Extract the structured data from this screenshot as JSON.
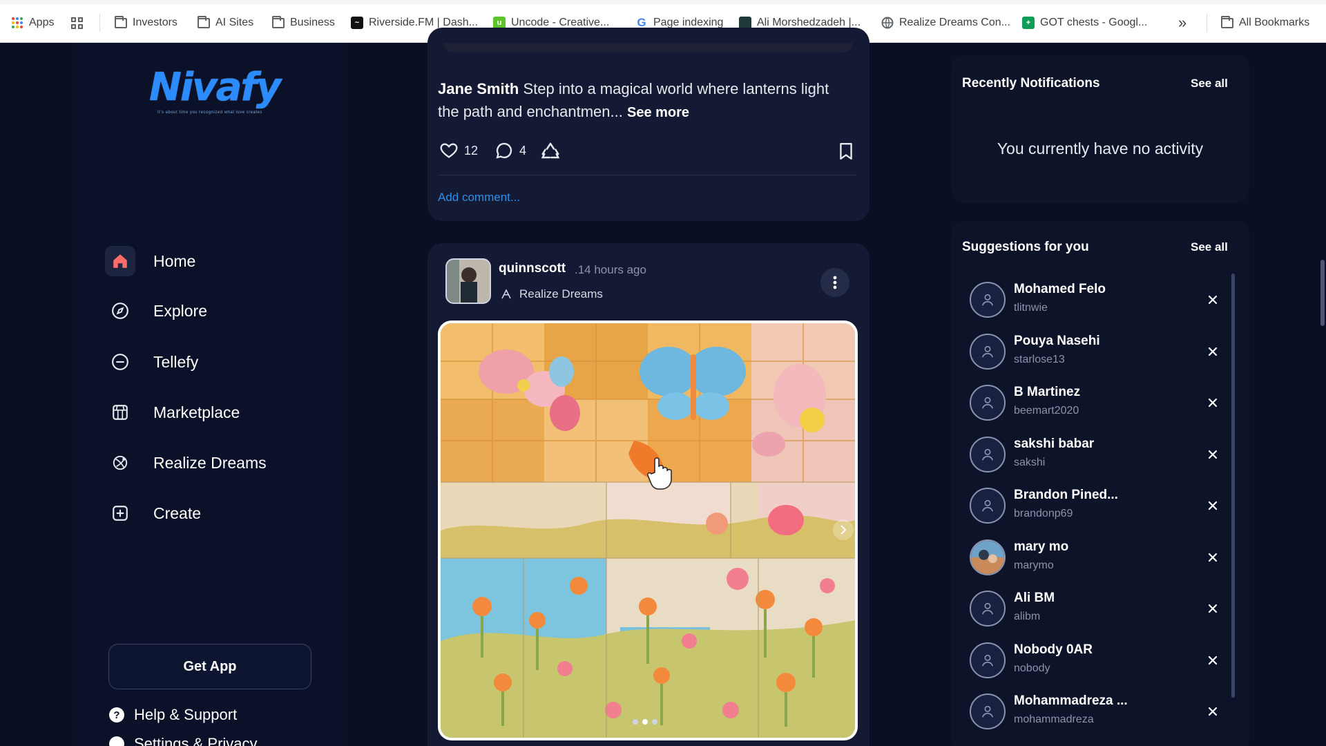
{
  "bookmarks": {
    "apps_label": "Apps",
    "items": [
      {
        "label": "Investors",
        "icon": "folder-icon"
      },
      {
        "label": "AI Sites",
        "icon": "folder-icon"
      },
      {
        "label": "Business",
        "icon": "folder-icon"
      },
      {
        "label": "Riverside.FM | Dash...",
        "icon": "riverside-icon"
      },
      {
        "label": "Uncode - Creative...",
        "icon": "uncode-icon"
      },
      {
        "label": "Page indexing",
        "icon": "google-icon"
      },
      {
        "label": "Ali Morshedzadeh |...",
        "icon": "site-icon"
      },
      {
        "label": "Realize Dreams Con...",
        "icon": "globe-icon"
      },
      {
        "label": "GOT chests - Googl...",
        "icon": "sheets-icon"
      }
    ],
    "overflow": "»",
    "all_bookmarks": "All Bookmarks"
  },
  "logo": {
    "text": "Nivafy",
    "tagline": "It's about time you recognized what love creates"
  },
  "nav": [
    {
      "label": "Home",
      "icon": "home-icon",
      "active": true
    },
    {
      "label": "Explore",
      "icon": "compass-icon",
      "active": false
    },
    {
      "label": "Tellefy",
      "icon": "chat-icon",
      "active": false
    },
    {
      "label": "Marketplace",
      "icon": "store-icon",
      "active": false
    },
    {
      "label": "Realize Dreams",
      "icon": "dreams-icon",
      "active": false
    },
    {
      "label": "Create",
      "icon": "plus-square-icon",
      "active": false
    }
  ],
  "sidebar_footer": {
    "get_app": "Get App",
    "help": "Help & Support",
    "settings": "Settings & Privacy"
  },
  "post1": {
    "author": "Jane Smith",
    "text": "Step into a magical world where lanterns light the path and enchantmen...",
    "see_more": "See more",
    "likes": "12",
    "comments": "4",
    "add_comment": "Add comment..."
  },
  "post2": {
    "username": "quinnscott",
    "time": ".14 hours ago",
    "group": "Realize Dreams",
    "image_alt": "tile mosaic of butterflies and flowers",
    "carousel_count": 3,
    "carousel_active": 2
  },
  "notifications": {
    "title": "Recently Notifications",
    "see_all": "See all",
    "empty": "You currently have no activity"
  },
  "suggestions": {
    "title": "Suggestions for you",
    "see_all": "See all",
    "users": [
      {
        "name": "Mohamed Felo",
        "username": "tlitnwie"
      },
      {
        "name": "Pouya Nasehi",
        "username": "starlose13"
      },
      {
        "name": "B Martinez",
        "username": "beemart2020"
      },
      {
        "name": "sakshi babar",
        "username": "sakshi"
      },
      {
        "name": "Brandon Pined...",
        "username": "brandonp69"
      },
      {
        "name": "mary mo",
        "username": "marymo"
      },
      {
        "name": "Ali BM",
        "username": "alibm"
      },
      {
        "name": "Nobody 0AR",
        "username": "nobody"
      },
      {
        "name": "Mohammadreza ...",
        "username": "mohammadreza"
      }
    ]
  },
  "colors": {
    "accent": "#2b8cff",
    "home_active": "#ff6b6b",
    "link": "#2e8fe6"
  }
}
